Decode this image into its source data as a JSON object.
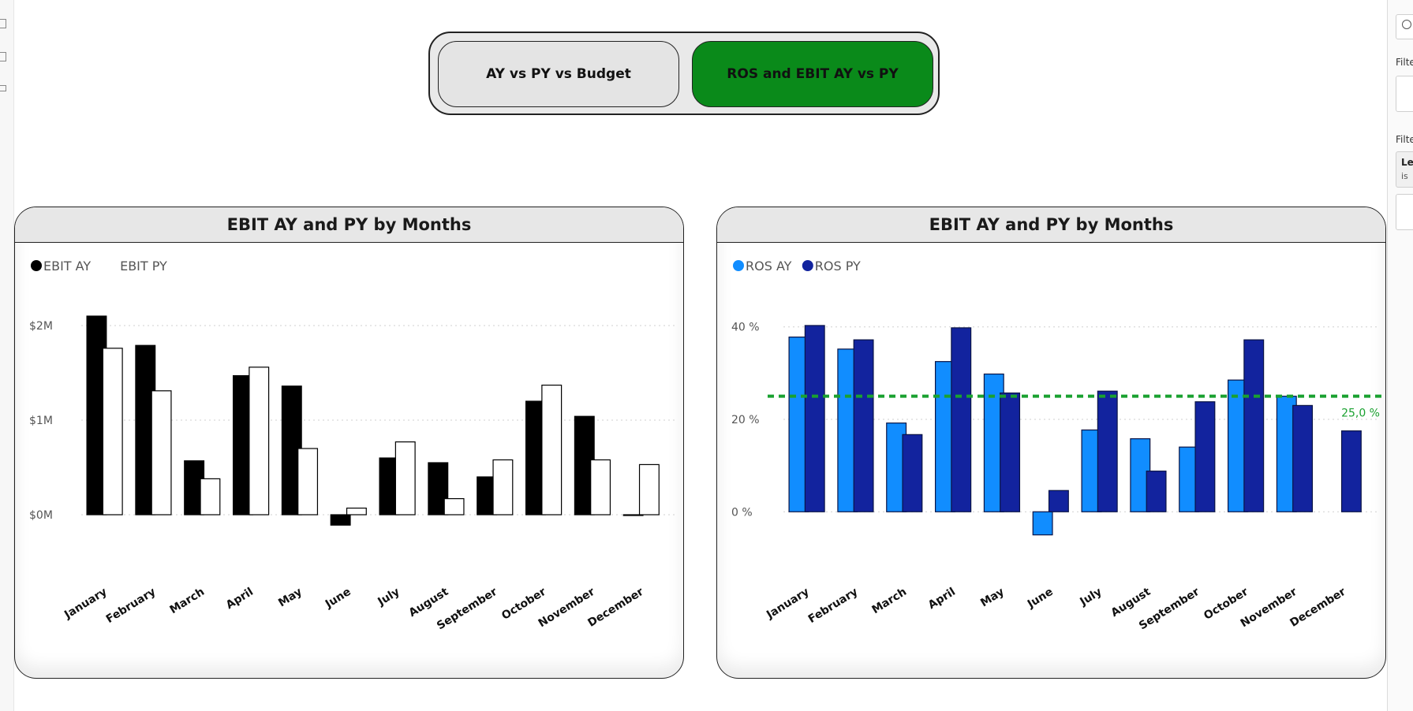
{
  "toggles": {
    "button_a": "AY vs PY vs Budget",
    "button_b": "ROS and EBIT AY vs PY"
  },
  "right_pane": {
    "label_1": "Filte",
    "label_2": "Filte",
    "card_line1": "Le",
    "card_line2": "is"
  },
  "colors": {
    "ebit_ay": "#000000",
    "ebit_py": "#ffffff",
    "ros_ay": "#118dff",
    "ros_py": "#12239e",
    "reference": "#1aa130",
    "button_active": "#0a8a1a"
  },
  "chart_data": [
    {
      "type": "bar",
      "title": "EBIT AY and PY by Months",
      "categories": [
        "January",
        "February",
        "March",
        "April",
        "May",
        "June",
        "July",
        "August",
        "September",
        "October",
        "November",
        "December"
      ],
      "series": [
        {
          "name": "EBIT AY",
          "values": [
            2.1,
            1.79,
            0.57,
            1.47,
            1.36,
            -0.11,
            0.6,
            0.55,
            0.4,
            1.2,
            1.04,
            0.0
          ]
        },
        {
          "name": "EBIT PY",
          "values": [
            1.76,
            1.31,
            0.38,
            1.56,
            0.7,
            0.07,
            0.77,
            0.17,
            0.58,
            1.37,
            0.58,
            0.53
          ]
        }
      ],
      "y_ticks": [
        {
          "value": 0,
          "label": "$0M"
        },
        {
          "value": 1,
          "label": "$1M"
        },
        {
          "value": 2,
          "label": "$2M"
        }
      ],
      "ylim": [
        -0.35,
        2.45
      ],
      "grid": true,
      "legend": "top-left"
    },
    {
      "type": "bar",
      "title": "EBIT AY and PY by Months",
      "categories": [
        "January",
        "February",
        "March",
        "April",
        "May",
        "June",
        "July",
        "August",
        "September",
        "October",
        "November",
        "December"
      ],
      "series": [
        {
          "name": "ROS AY",
          "values": [
            37.8,
            35.2,
            19.2,
            32.5,
            29.8,
            -5.0,
            17.7,
            15.8,
            14.0,
            28.5,
            25.0,
            null
          ]
        },
        {
          "name": "ROS PY",
          "values": [
            40.3,
            37.2,
            16.7,
            39.8,
            25.7,
            4.6,
            26.1,
            8.8,
            23.8,
            37.2,
            23.0,
            17.5
          ]
        }
      ],
      "reference_line": {
        "value": 25.0,
        "label": "25,0 %"
      },
      "y_ticks": [
        {
          "value": 0,
          "label": "0 %"
        },
        {
          "value": 20,
          "label": "20 %"
        },
        {
          "value": 40,
          "label": "40 %"
        }
      ],
      "ylim": [
        -7.8,
        49.5
      ],
      "grid": true,
      "legend": "top-left"
    }
  ]
}
